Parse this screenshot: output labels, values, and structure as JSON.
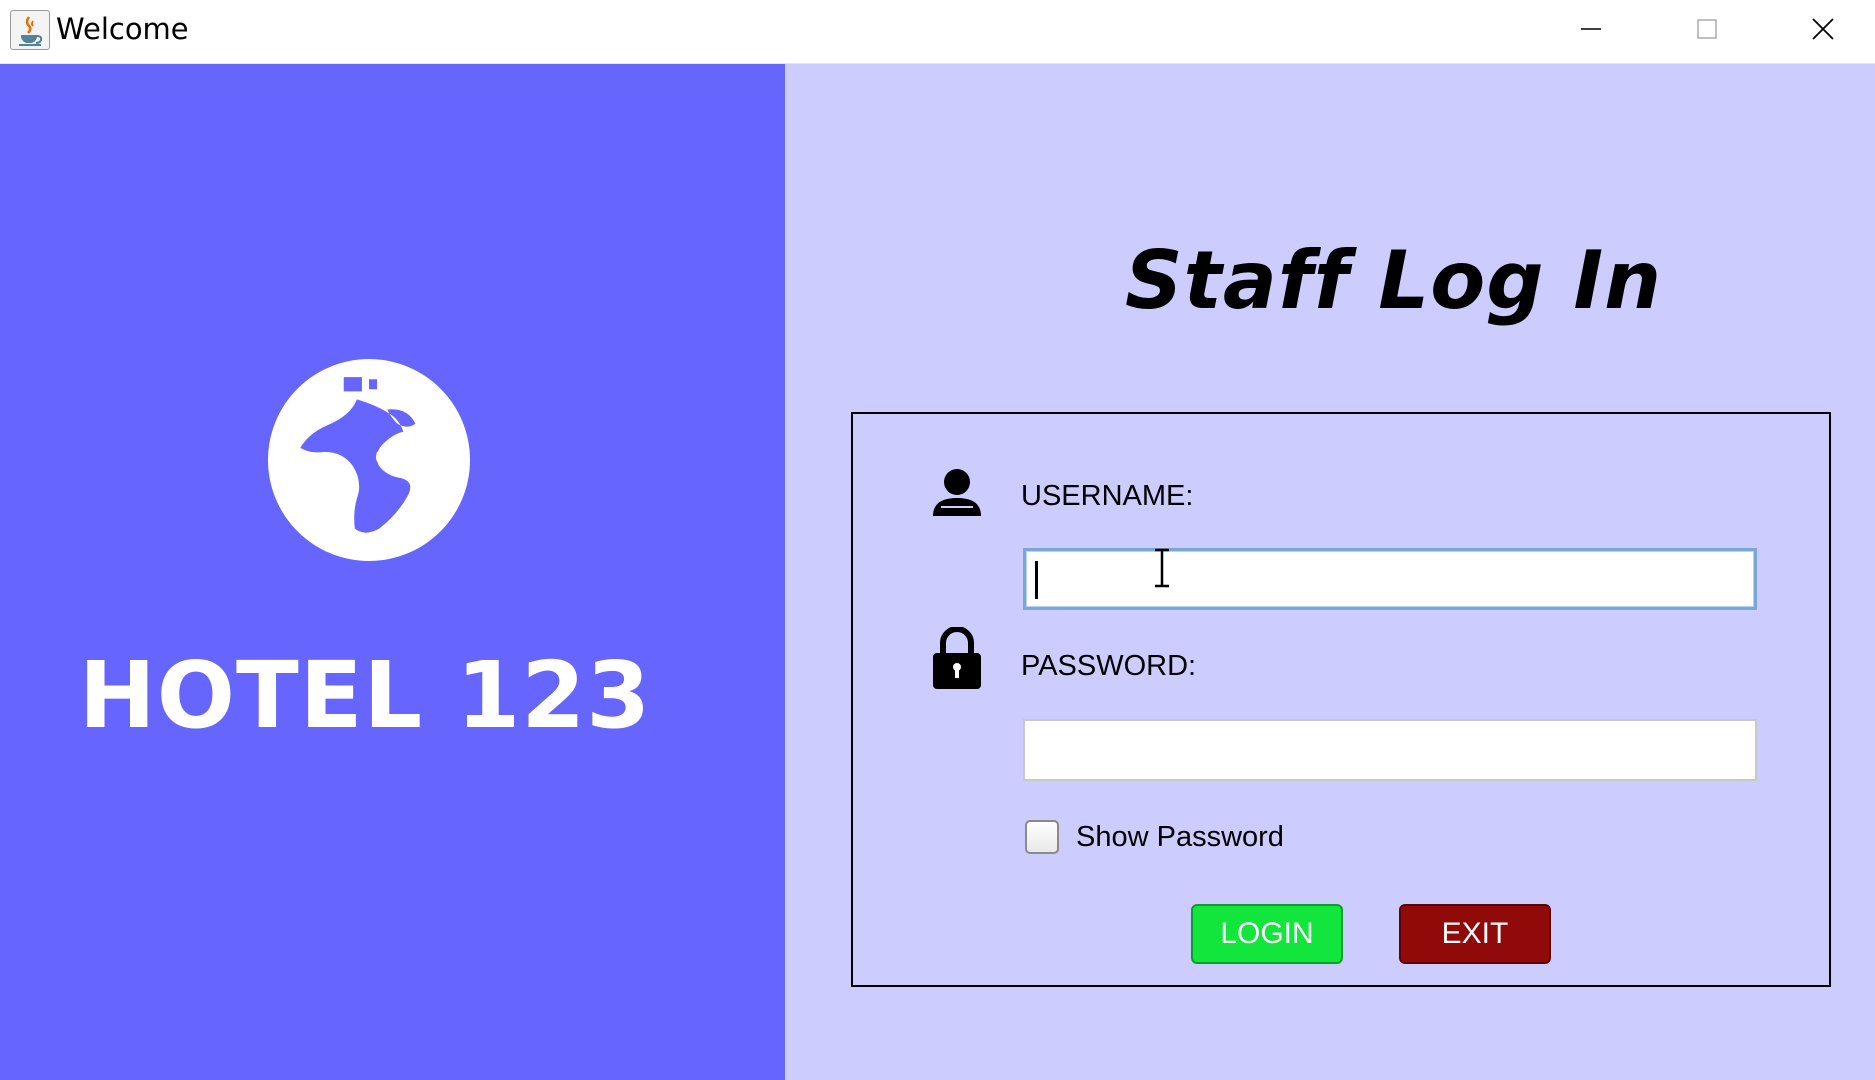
{
  "window": {
    "title": "Welcome",
    "app_icon": "java-coffee-cup-icon",
    "controls": [
      "minimize-icon",
      "maximize-icon",
      "close-icon"
    ]
  },
  "brand": {
    "logo_icon": "globe-icon",
    "name": "HOTEL 123",
    "panel_color": "#6666ff"
  },
  "login": {
    "title": "Staff Log In",
    "panel_color": "#ccccfe",
    "username": {
      "icon": "user-icon",
      "label": "USERNAME:",
      "value": "",
      "focused": true
    },
    "password": {
      "icon": "lock-icon",
      "label": "PASSWORD:",
      "value": ""
    },
    "show_password": {
      "label": "Show Password",
      "checked": false
    },
    "buttons": {
      "login": {
        "label": "LOGIN",
        "color": "#12e53c"
      },
      "exit": {
        "label": "EXIT",
        "color": "#900a0a"
      }
    }
  }
}
